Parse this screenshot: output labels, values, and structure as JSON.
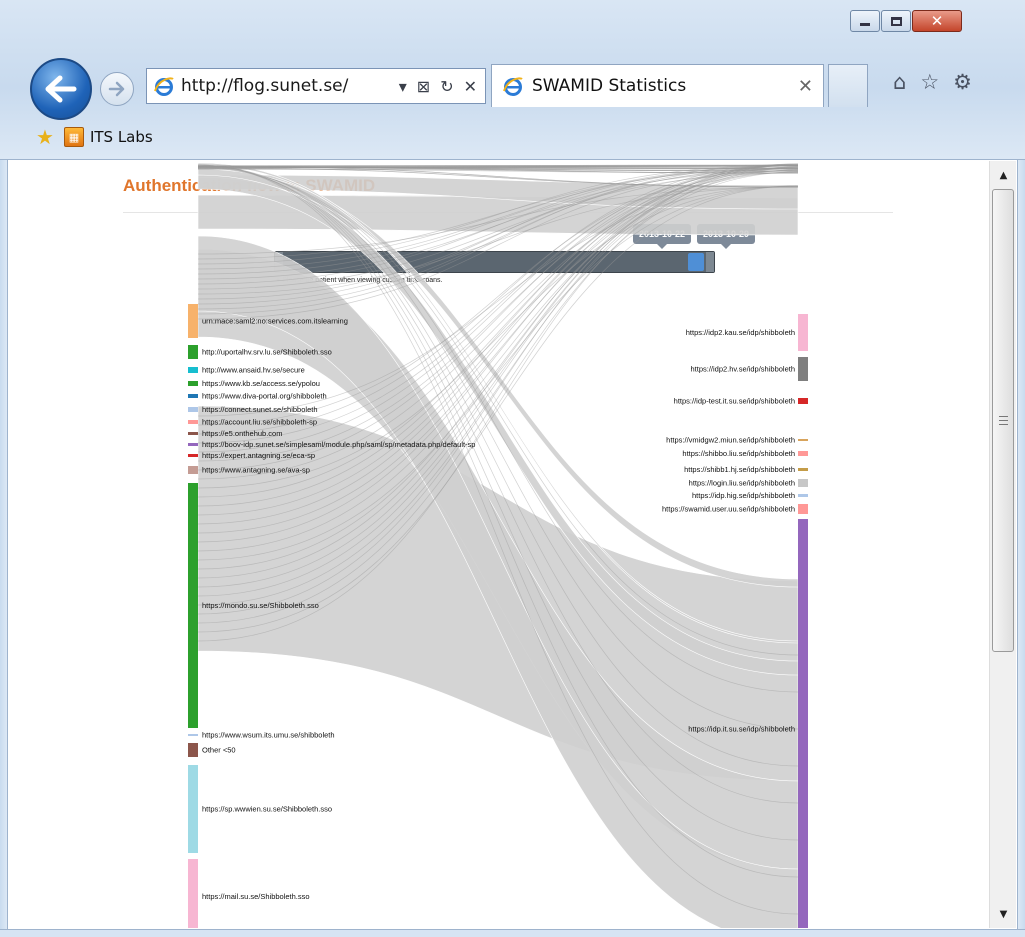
{
  "browser": {
    "address": "http://flog.sunet.se/",
    "tab_title": "SWAMID Statistics",
    "favorite_label": "ITS Labs"
  },
  "page": {
    "title": "Authentication flow in SWAMID",
    "slider": {
      "date_from": "2013-10-22",
      "date_to": "2013-10-29",
      "note": "Please be patient when viewing custom time spans."
    }
  },
  "sankey": {
    "sources": [
      {
        "label": "urn:mace:saml2:no:services.com.itslearning",
        "color": "#f7b26b"
      },
      {
        "label": "http://uportalhv.srv.lu.se/Shibboleth.sso",
        "color": "#2ca02c"
      },
      {
        "label": "http://www.ansaid.hv.se/secure",
        "color": "#17becf"
      },
      {
        "label": "https://www.kb.se/access.se/ypolou",
        "color": "#2ca02c"
      },
      {
        "label": "https://www.diva-portal.org/shibboleth",
        "color": "#1f77b4"
      },
      {
        "label": "https://connect.sunet.se/shibboleth",
        "color": "#aec7e8"
      },
      {
        "label": "https://account.liu.se/shibboleth-sp",
        "color": "#ff9896"
      },
      {
        "label": "https://e5.onthehub.com",
        "color": "#8c564b"
      },
      {
        "label": "https://boov-idp.sunet.se/simplesaml/module.php/saml/sp/metadata.php/default-sp",
        "color": "#9467bd"
      },
      {
        "label": "https://expert.antagning.se/eca-sp",
        "color": "#d62728"
      },
      {
        "label": "https://www.antagning.se/ava-sp",
        "color": "#c49c94"
      },
      {
        "label": "https://mondo.su.se/Shibboleth.sso",
        "color": "#2ca02c"
      },
      {
        "label": "https://www.wsum.its.umu.se/shibboleth",
        "color": "#aec7e8"
      },
      {
        "label": "Other <50",
        "color": "#8c564b"
      },
      {
        "label": "https://sp.wwwien.su.se/Shibboleth.sso",
        "color": "#9edae5"
      },
      {
        "label": "https://mail.su.se/Shibboleth.sso",
        "color": "#f7b6d2"
      }
    ],
    "targets": [
      {
        "label": "https://idp2.kau.se/idp/shibboleth",
        "color": "#f7b6d2"
      },
      {
        "label": "https://idp2.hv.se/idp/shibboleth",
        "color": "#7f7f7f"
      },
      {
        "label": "https://idp-test.it.su.se/idp/shibboleth",
        "color": "#d62728"
      },
      {
        "label": "https://vmidgw2.miun.se/idp/shibboleth",
        "color": "#d8a45c"
      },
      {
        "label": "https://shibbo.liu.se/idp/shibboleth",
        "color": "#ff9896"
      },
      {
        "label": "https://shibb1.hj.se/idp/shibboleth",
        "color": "#c49c48"
      },
      {
        "label": "https://login.liu.se/idp/shibboleth",
        "color": "#c7c7c7"
      },
      {
        "label": "https://idp.hig.se/idp/shibboleth",
        "color": "#aec7e8"
      },
      {
        "label": "https://swamid.user.uu.se/idp/shibboleth",
        "color": "#ff9896"
      },
      {
        "label": "https://idp.it.su.se/idp/shibboleth",
        "color": "#9467bd"
      }
    ]
  }
}
